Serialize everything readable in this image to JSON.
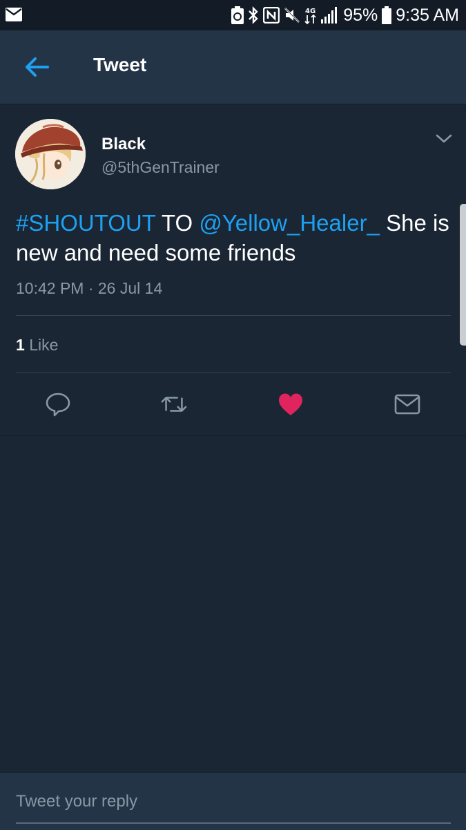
{
  "status_bar": {
    "battery_percent": "95%",
    "time": "9:35 AM"
  },
  "header": {
    "title": "Tweet"
  },
  "tweet": {
    "display_name": "Black",
    "handle": "@5thGenTrainer",
    "text": {
      "hashtag": "#SHOUTOUT",
      "plain_1": " TO ",
      "mention": "@Yellow_Healer_",
      "plain_2": " She is new and need some friends"
    },
    "timestamp": "10:42 PM · 26 Jul 14",
    "likes": {
      "count": "1",
      "label": "Like"
    },
    "liked": true
  },
  "reply": {
    "placeholder": "Tweet your reply"
  },
  "colors": {
    "background": "#1b2634",
    "header": "#243447",
    "link": "#1da1f2",
    "muted": "#8899a6",
    "like": "#e0245e"
  }
}
